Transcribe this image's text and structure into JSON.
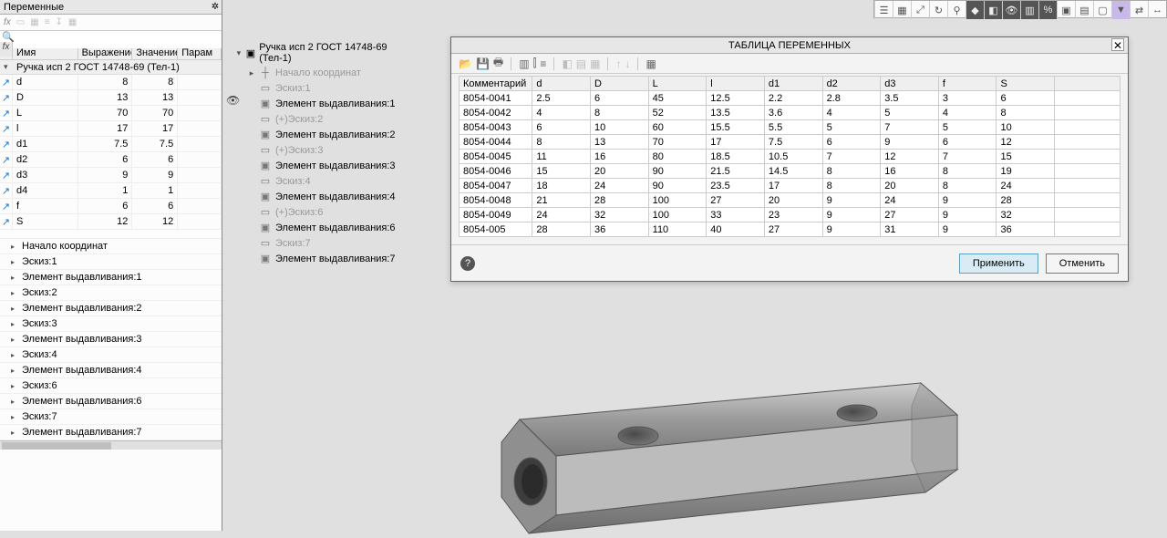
{
  "left_panel": {
    "title": "Переменные",
    "headers": [
      "Имя",
      "Выражение",
      "Значение",
      "Парам"
    ],
    "root_label": "Ручка исп 2 ГОСТ 14748-69 (Тел-1)",
    "vars": [
      {
        "n": "d",
        "e": "8",
        "v": "8"
      },
      {
        "n": "D",
        "e": "13",
        "v": "13"
      },
      {
        "n": "L",
        "e": "70",
        "v": "70"
      },
      {
        "n": "l",
        "e": "17",
        "v": "17"
      },
      {
        "n": "d1",
        "e": "7.5",
        "v": "7.5"
      },
      {
        "n": "d2",
        "e": "6",
        "v": "6"
      },
      {
        "n": "d3",
        "e": "9",
        "v": "9"
      },
      {
        "n": "d4",
        "e": "1",
        "v": "1"
      },
      {
        "n": "f",
        "e": "6",
        "v": "6"
      },
      {
        "n": "S",
        "e": "12",
        "v": "12"
      }
    ],
    "tree": [
      "Начало координат",
      "Эскиз:1",
      "Элемент выдавливания:1",
      "Эскиз:2",
      "Элемент выдавливания:2",
      "Эскиз:3",
      "Элемент выдавливания:3",
      "Эскиз:4",
      "Элемент выдавливания:4",
      "Эскиз:6",
      "Элемент выдавливания:6",
      "Эскиз:7",
      "Элемент выдавливания:7"
    ]
  },
  "model_tree": {
    "root": "Ручка исп 2 ГОСТ 14748-69 (Тел-1)",
    "items": [
      {
        "t": "Начало координат",
        "g": true,
        "i": "┼"
      },
      {
        "t": "Эскиз:1",
        "g": true,
        "i": "▭"
      },
      {
        "t": "Элемент выдавливания:1",
        "g": false,
        "i": "▣"
      },
      {
        "t": "(+)Эскиз:2",
        "g": true,
        "i": "▭"
      },
      {
        "t": "Элемент выдавливания:2",
        "g": false,
        "i": "▣"
      },
      {
        "t": "(+)Эскиз:3",
        "g": true,
        "i": "▭"
      },
      {
        "t": "Элемент выдавливания:3",
        "g": false,
        "i": "▣"
      },
      {
        "t": "Эскиз:4",
        "g": true,
        "i": "▭"
      },
      {
        "t": "Элемент выдавливания:4",
        "g": false,
        "i": "▣"
      },
      {
        "t": "(+)Эскиз:6",
        "g": true,
        "i": "▭"
      },
      {
        "t": "Элемент выдавливания:6",
        "g": false,
        "i": "▣"
      },
      {
        "t": "Эскиз:7",
        "g": true,
        "i": "▭"
      },
      {
        "t": "Элемент выдавливания:7",
        "g": false,
        "i": "▣"
      }
    ]
  },
  "dialog": {
    "title": "ТАБЛИЦА ПЕРЕМЕННЫХ",
    "cols": [
      "Комментарий",
      "d",
      "D",
      "L",
      "l",
      "d1",
      "d2",
      "d3",
      "f",
      "S"
    ],
    "rows": [
      [
        "8054-0041",
        "2.5",
        "6",
        "45",
        "12.5",
        "2.2",
        "2.8",
        "3.5",
        "3",
        "6"
      ],
      [
        "8054-0042",
        "4",
        "8",
        "52",
        "13.5",
        "3.6",
        "4",
        "5",
        "4",
        "8"
      ],
      [
        "8054-0043",
        "6",
        "10",
        "60",
        "15.5",
        "5.5",
        "5",
        "7",
        "5",
        "10"
      ],
      [
        "8054-0044",
        "8",
        "13",
        "70",
        "17",
        "7.5",
        "6",
        "9",
        "6",
        "12"
      ],
      [
        "8054-0045",
        "11",
        "16",
        "80",
        "18.5",
        "10.5",
        "7",
        "12",
        "7",
        "15"
      ],
      [
        "8054-0046",
        "15",
        "20",
        "90",
        "21.5",
        "14.5",
        "8",
        "16",
        "8",
        "19"
      ],
      [
        "8054-0047",
        "18",
        "24",
        "90",
        "23.5",
        "17",
        "8",
        "20",
        "8",
        "24"
      ],
      [
        "8054-0048",
        "21",
        "28",
        "100",
        "27",
        "20",
        "9",
        "24",
        "9",
        "28"
      ],
      [
        "8054-0049",
        "24",
        "32",
        "100",
        "33",
        "23",
        "9",
        "27",
        "9",
        "32"
      ],
      [
        "8054-005",
        "28",
        "36",
        "110",
        "40",
        "27",
        "9",
        "31",
        "9",
        "36"
      ]
    ],
    "apply": "Применить",
    "cancel": "Отменить"
  }
}
